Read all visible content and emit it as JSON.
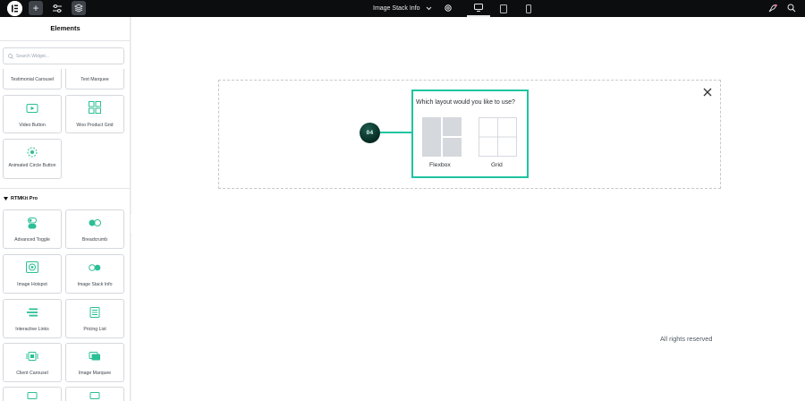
{
  "topbar": {
    "add_label": "+",
    "page_title": "Image Stack Info",
    "icons": [
      "elementor-logo-icon",
      "plus-icon",
      "settings-sliders-icon",
      "layers-icon",
      "chevron-down-icon",
      "gear-icon",
      "desktop-icon",
      "tablet-icon",
      "mobile-icon",
      "rocket-icon",
      "search-icon"
    ]
  },
  "sidebar": {
    "title": "Elements",
    "search_placeholder": "Search Widget...",
    "top_widgets": [
      {
        "label": "Testimonial Carousel",
        "icon": "testimonial-icon"
      },
      {
        "label": "Text Marquee",
        "icon": "marquee-icon"
      },
      {
        "label": "Video Button",
        "icon": "video-icon"
      },
      {
        "label": "Woo Product Grid",
        "icon": "grid-icon"
      },
      {
        "label": "Animated Circle Button",
        "icon": "circle-button-icon"
      }
    ],
    "section_title": "RTMKit Pro",
    "pro_widgets": [
      {
        "label": "Advanced Toggle",
        "icon": "toggle-icon"
      },
      {
        "label": "Breadcrumb",
        "icon": "breadcrumb-icon"
      },
      {
        "label": "Image Hotspot",
        "icon": "hotspot-icon"
      },
      {
        "label": "Image Stack Info",
        "icon": "stack-icon"
      },
      {
        "label": "Interactive Links",
        "icon": "links-icon"
      },
      {
        "label": "Pricing List",
        "icon": "pricing-icon"
      },
      {
        "label": "Client Carousel",
        "icon": "carousel-icon"
      },
      {
        "label": "Image Marquee",
        "icon": "image-marquee-icon"
      }
    ]
  },
  "canvas": {
    "step_number": "04",
    "question": "Which layout would you like to use?",
    "options": [
      {
        "label": "Flexbox",
        "icon": "flexbox-layout-icon"
      },
      {
        "label": "Grid",
        "icon": "grid-layout-icon"
      }
    ],
    "footer": "All rights reserved"
  },
  "colors": {
    "accent": "#1ec4a2",
    "topbar": "#0c0d0e",
    "widget_icon": "#2bbf96",
    "step_badge": "#0a3b30"
  }
}
